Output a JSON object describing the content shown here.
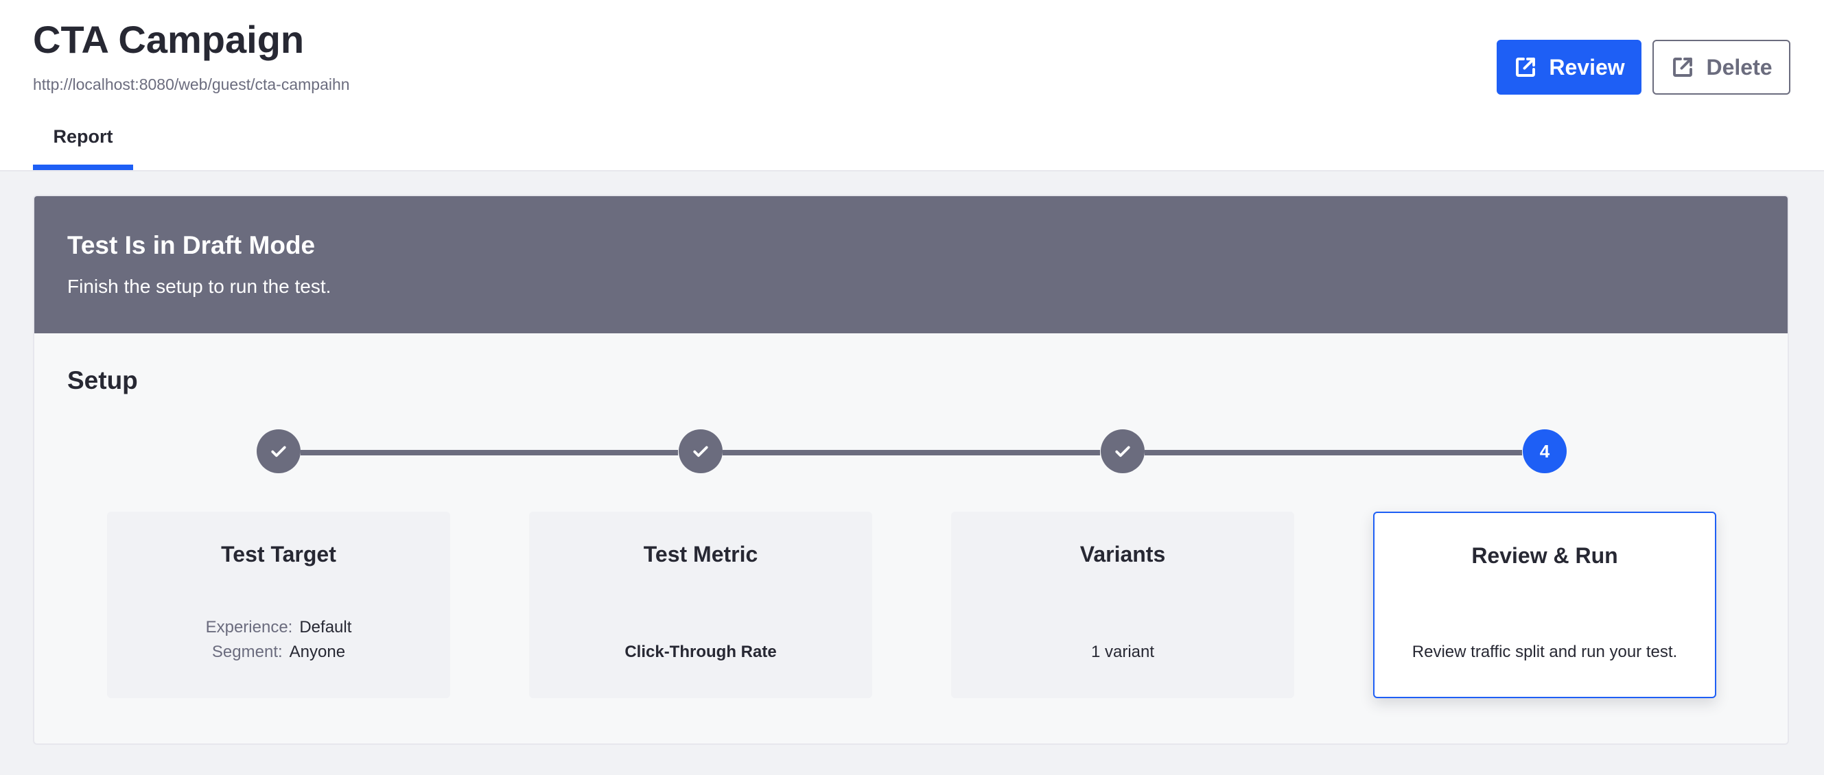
{
  "header": {
    "title": "CTA Campaign",
    "url": "http://localhost:8080/web/guest/cta-campaihn",
    "review_label": "Review",
    "delete_label": "Delete",
    "tabs": [
      {
        "label": "Report",
        "active": true
      }
    ]
  },
  "banner": {
    "title": "Test Is in Draft Mode",
    "text": "Finish the setup to run the test."
  },
  "setup": {
    "title": "Setup",
    "steps": [
      {
        "status": "complete",
        "icon": "check-icon",
        "title": "Test Target",
        "details": [
          {
            "label": "Experience:",
            "value": "Default"
          },
          {
            "label": "Segment:",
            "value": "Anyone"
          }
        ]
      },
      {
        "status": "complete",
        "icon": "check-icon",
        "title": "Test Metric",
        "summary": "Click-Through Rate"
      },
      {
        "status": "complete",
        "icon": "check-icon",
        "title": "Variants",
        "summary": "1 variant"
      },
      {
        "status": "active",
        "number": "4",
        "title": "Review & Run",
        "summary": "Review traffic split and run your test."
      }
    ]
  },
  "colors": {
    "accent": "#1e5ff5",
    "banner_bg": "#6b6c7e",
    "page_bg": "#f1f2f5",
    "text": "#272833",
    "muted_text": "#6b6c7e"
  }
}
